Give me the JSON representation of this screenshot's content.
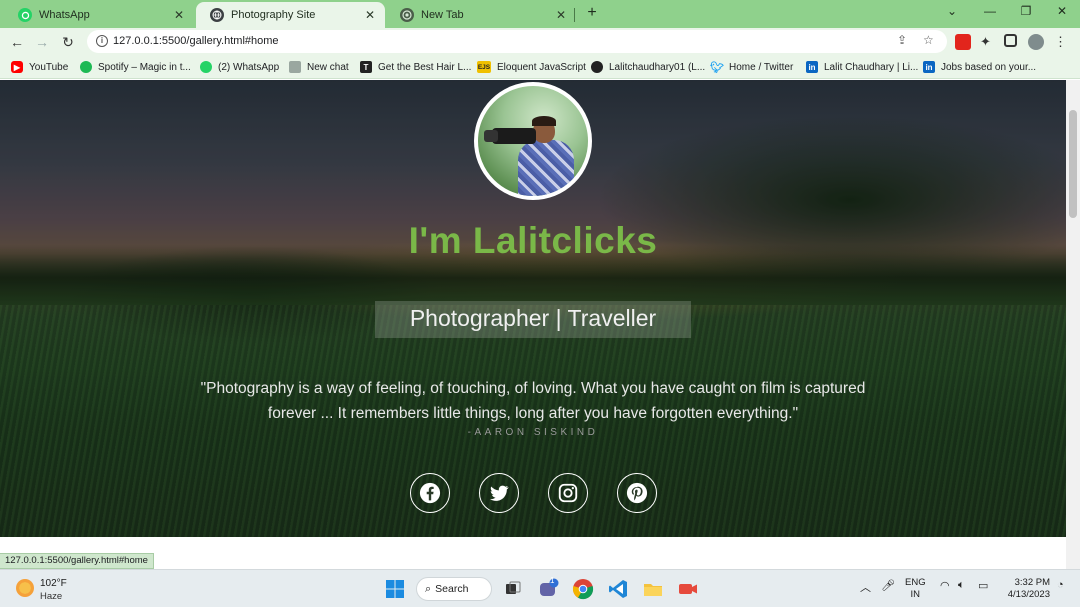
{
  "browser": {
    "tabs": [
      {
        "title": "WhatsApp",
        "icon": "whatsapp-icon",
        "active": false
      },
      {
        "title": "Photography Site",
        "icon": "globe-icon",
        "active": true
      },
      {
        "title": "New Tab",
        "icon": "chrome-icon",
        "active": false
      }
    ],
    "new_tab_symbol": "+",
    "url": "127.0.0.1:5500/gallery.html#home",
    "status_url": "127.0.0.1:5500/gallery.html#home"
  },
  "bookmarks": [
    {
      "label": "YouTube",
      "icon": "youtube-icon",
      "color": "#ff0000"
    },
    {
      "label": "Spotify – Magic in t...",
      "icon": "spotify-icon",
      "color": "#1db954"
    },
    {
      "label": "(2) WhatsApp",
      "icon": "whatsapp-icon",
      "color": "#25d366"
    },
    {
      "label": "New chat",
      "icon": "chat-icon",
      "color": "#9aa7a0"
    },
    {
      "label": "Get the Best Hair L...",
      "icon": "t-logo-icon",
      "color": "#222222",
      "glyph": "T"
    },
    {
      "label": "Eloquent JavaScript",
      "icon": "ejs-icon",
      "color": "#f0c000",
      "glyph": "EJS"
    },
    {
      "label": "Lalitchaudhary01 (L...",
      "icon": "github-icon",
      "color": "#222222"
    },
    {
      "label": "Home / Twitter",
      "icon": "twitter-icon",
      "color": "#1da1f2"
    },
    {
      "label": "Lalit Chaudhary | Li...",
      "icon": "linkedin-icon",
      "color": "#0a66c2",
      "glyph": "in"
    },
    {
      "label": "Jobs based on your...",
      "icon": "linkedin-icon",
      "color": "#0a66c2",
      "glyph": "in"
    }
  ],
  "hero": {
    "headline": "I'm Lalitclicks",
    "tagline": "Photographer | Traveller",
    "quote": "\"Photography is a way of feeling, of touching, of loving. What you have caught on film is captured forever ... It remembers little things, long after you have forgotten everything.\"",
    "author": "-AARON SISKIND",
    "accent_color": "#7ab848",
    "social": [
      "facebook-icon",
      "twitter-icon",
      "instagram-icon",
      "pinterest-icon"
    ]
  },
  "taskbar": {
    "weather_temp": "102°F",
    "weather_condition": "Haze",
    "search_label": "Search",
    "chat_badge": "1",
    "lang_line1": "ENG",
    "lang_line2": "IN",
    "time": "3:32 PM",
    "date": "4/13/2023"
  }
}
